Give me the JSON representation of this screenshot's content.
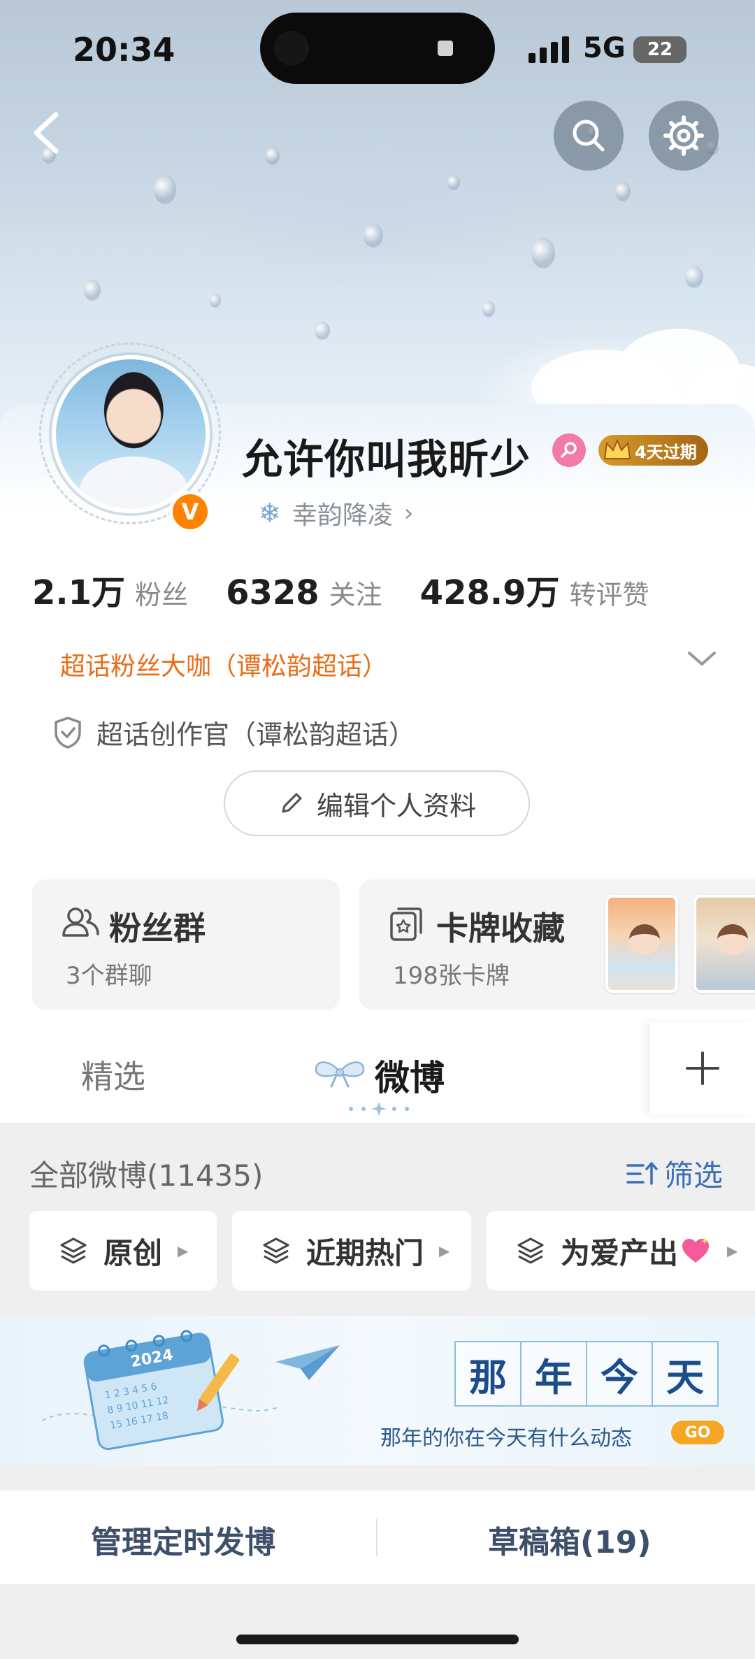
{
  "status": {
    "time": "20:34",
    "network": "5G",
    "battery": "22"
  },
  "profile": {
    "name": "允许你叫我昕少",
    "vip_label": "4天过期",
    "group": "幸韵降凌",
    "stats": [
      {
        "value": "2.1万",
        "label": "粉丝"
      },
      {
        "value": "6328",
        "label": "关注"
      },
      {
        "value": "428.9万",
        "label": "转评赞"
      }
    ],
    "tag_primary": "超话粉丝大咖（谭松韵超话）",
    "tag_secondary": "超话创作官（谭松韵超话）",
    "edit_label": "编辑个人资料"
  },
  "cards": {
    "fans_title": "粉丝群",
    "fans_sub": "3个群聊",
    "collect_title": "卡牌收藏",
    "collect_sub": "198张卡牌"
  },
  "tabs": {
    "featured": "精选",
    "weibo": "微博"
  },
  "feed": {
    "all_posts": "全部微博(11435)",
    "filter": "筛选",
    "chips": [
      "原创",
      "近期热门",
      "为爱产出"
    ],
    "memory_title": [
      "那",
      "年",
      "今",
      "天"
    ],
    "memory_sub": "那年的你在今天有什么动态",
    "memory_go": "GO",
    "schedule": "管理定时发博",
    "drafts": "草稿箱(19)"
  },
  "colors": {
    "accent": "#ff8200",
    "tag_orange": "#e86d15",
    "link_blue": "#3c6fb6"
  }
}
